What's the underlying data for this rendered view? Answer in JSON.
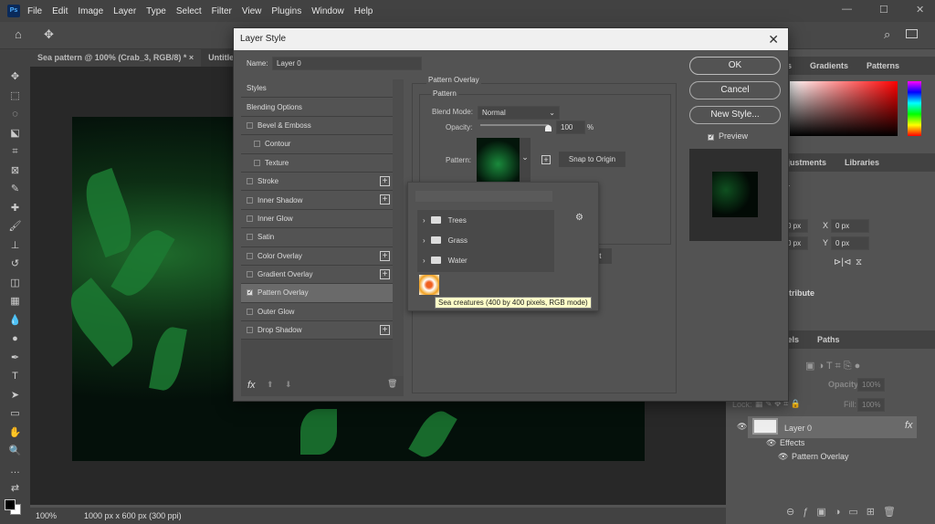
{
  "app": {
    "logo": "Ps",
    "menu": [
      "File",
      "Edit",
      "Image",
      "Layer",
      "Type",
      "Select",
      "Filter",
      "View",
      "Plugins",
      "Window",
      "Help"
    ]
  },
  "tabs": [
    "Sea pattern @ 100% (Crab_3, RGB/8) *",
    "Untitled"
  ],
  "status": {
    "zoom": "100%",
    "doc_size": "1000 px x 600 px (300 ppi)"
  },
  "dialog": {
    "title": "Layer Style",
    "name_label": "Name:",
    "name_value": "Layer 0",
    "styles": [
      {
        "label": "Styles",
        "checkbox": false,
        "plus": false,
        "indent": false
      },
      {
        "label": "Blending Options",
        "checkbox": false,
        "plus": false,
        "indent": false
      },
      {
        "label": "Bevel & Emboss",
        "checkbox": true,
        "plus": false,
        "indent": false
      },
      {
        "label": "Contour",
        "checkbox": true,
        "plus": false,
        "indent": true
      },
      {
        "label": "Texture",
        "checkbox": true,
        "plus": false,
        "indent": true
      },
      {
        "label": "Stroke",
        "checkbox": true,
        "plus": true,
        "indent": false
      },
      {
        "label": "Inner Shadow",
        "checkbox": true,
        "plus": true,
        "indent": false
      },
      {
        "label": "Inner Glow",
        "checkbox": true,
        "plus": false,
        "indent": false
      },
      {
        "label": "Satin",
        "checkbox": true,
        "plus": false,
        "indent": false
      },
      {
        "label": "Color Overlay",
        "checkbox": true,
        "plus": true,
        "indent": false
      },
      {
        "label": "Gradient Overlay",
        "checkbox": true,
        "plus": true,
        "indent": false
      },
      {
        "label": "Pattern Overlay",
        "checkbox": true,
        "checked": true,
        "selected": true,
        "plus": false,
        "indent": false
      },
      {
        "label": "Outer Glow",
        "checkbox": true,
        "plus": false,
        "indent": false
      },
      {
        "label": "Drop Shadow",
        "checkbox": true,
        "plus": true,
        "indent": false
      }
    ],
    "fx_label": "fx",
    "section": "Pattern Overlay",
    "group": "Pattern",
    "blend_mode_label": "Blend Mode:",
    "blend_mode": "Normal",
    "opacity_label": "Opacity:",
    "opacity": "100",
    "opacity_unit": "%",
    "pattern_label": "Pattern:",
    "snap_button": "Snap to Origin",
    "default_button_partial": "ult",
    "picker": {
      "folders": [
        "Trees",
        "Grass",
        "Water"
      ],
      "tooltip": "Sea creatures (400 by 400 pixels, RGB mode)"
    },
    "buttons": {
      "ok": "OK",
      "cancel": "Cancel",
      "new_style": "New Style...",
      "preview": "Preview"
    },
    "preview_checked": true
  },
  "right_panel": {
    "tabs1": [
      "es",
      "Gradients",
      "Patterns"
    ],
    "tabs2": [
      "djustments",
      "Libraries"
    ],
    "props_partial": "r",
    "w": "0 px",
    "h": "0 px",
    "x_label": "X",
    "x": "0 px",
    "y_label": "Y",
    "y": "0 px",
    "distribute": "stribute",
    "tabs3": [
      "nels",
      "Paths"
    ],
    "opacity_label": "Opacity:",
    "opacity": "100%",
    "lock_label": "Lock:",
    "fill_label": "Fill:",
    "fill": "100%",
    "layer": {
      "name": "Layer 0",
      "fx": "fx",
      "effects": "Effects",
      "effect_item": "Pattern Overlay"
    }
  }
}
